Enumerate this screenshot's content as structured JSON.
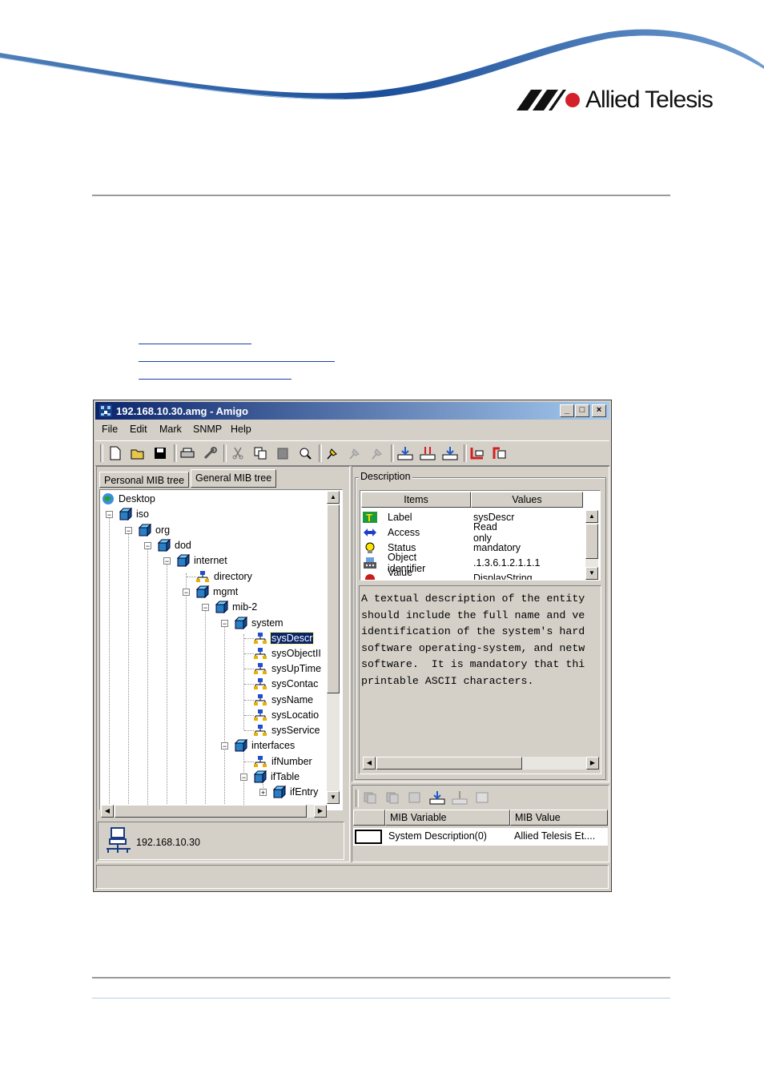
{
  "brand": {
    "logo_text": "Allied Telesis"
  },
  "window": {
    "title": "192.168.10.30.amg - Amigo",
    "controls": {
      "minimize": "_",
      "maximize": "□",
      "close": "×"
    },
    "menu": [
      "File",
      "Edit",
      "Mark",
      "SNMP",
      "Help"
    ],
    "tabs": {
      "personal": "Personal MIB tree",
      "general": "General MIB tree"
    },
    "tree": {
      "desktop": "Desktop",
      "iso": "iso",
      "org": "org",
      "dod": "dod",
      "internet": "internet",
      "directory": "directory",
      "mgmt": "mgmt",
      "mib2": "mib-2",
      "system": "system",
      "sysDescr": "sysDescr",
      "sysObjectID": "sysObjectII",
      "sysUpTime": "sysUpTime",
      "sysContact": "sysContac",
      "sysName": "sysName",
      "sysLocation": "sysLocatio",
      "sysServices": "sysService",
      "interfaces": "interfaces",
      "ifNumber": "ifNumber",
      "ifTable": "ifTable",
      "ifEntry": "ifEntry"
    },
    "host_ip": "192.168.10.30",
    "description": {
      "group_label": "Description",
      "columns": [
        "Items",
        "Values"
      ],
      "rows": [
        {
          "item": "Label",
          "value": "sysDescr"
        },
        {
          "item": "Access",
          "value": "Read only"
        },
        {
          "item": "Status",
          "value": "mandatory"
        },
        {
          "item": "Object identifier",
          "value": ".1.3.6.1.2.1.1.1"
        },
        {
          "item": "Value type",
          "value": "DisplayString"
        }
      ],
      "text": [
        "A textual description of the entity",
        "should include the full name and ve",
        "identification of the system's hard",
        "software operating-system, and netw",
        "software.  It is mandatory that thi",
        "printable ASCII characters."
      ]
    },
    "mib_table": {
      "columns": [
        "MIB Variable",
        "MIB Value"
      ],
      "row": {
        "variable": "System Description(0)",
        "value": "Allied Telesis Et...."
      }
    }
  }
}
